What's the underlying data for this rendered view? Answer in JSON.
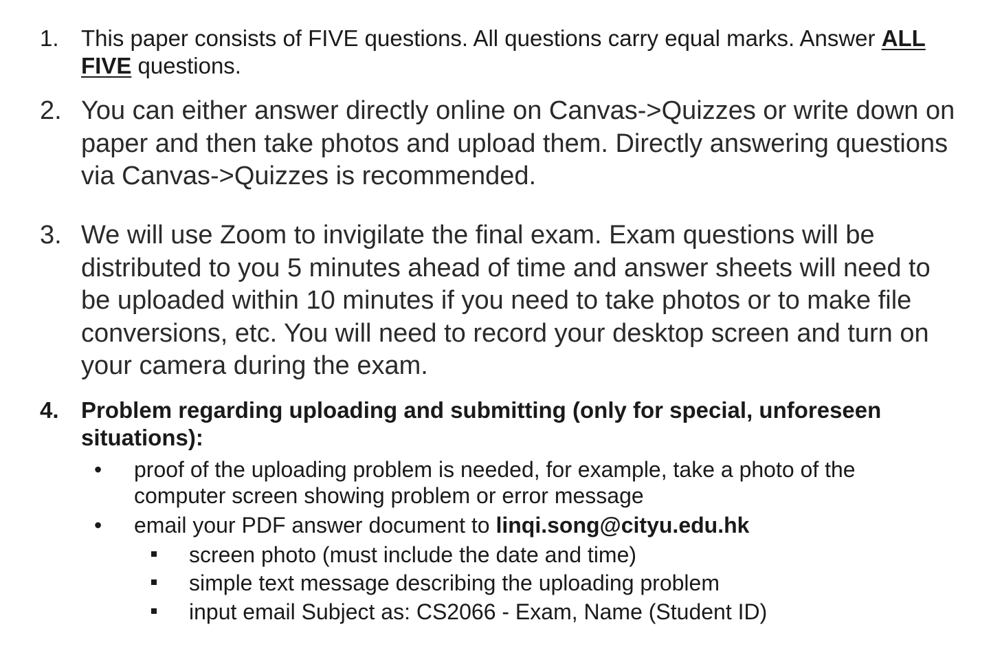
{
  "items": [
    {
      "number": "1.",
      "text_a": "This paper consists of FIVE questions. All questions carry equal marks. Answer ",
      "emph_all": "ALL",
      "emph_five": "FIVE",
      "text_b": " questions."
    },
    {
      "number": "2.",
      "text": "You can either answer directly online on Canvas->Quizzes or write down on paper and then take photos and upload them.  Directly answering questions via Canvas->Quizzes is recommended."
    },
    {
      "number": "3.",
      "text": "We will use Zoom to invigilate the final exam. Exam questions will be distributed to you 5 minutes ahead of time and answer sheets will need to be uploaded within 10 minutes if you need to take photos or to make file conversions, etc. You will need to record your desktop screen and turn on your camera during the exam."
    },
    {
      "number": "4.",
      "text": "Problem regarding uploading and submitting (only for special, unforeseen situations):",
      "bullets": [
        {
          "marker": "•",
          "text": "proof of the uploading problem is needed, for example, take a photo of the computer screen showing problem or error message"
        },
        {
          "marker": "•",
          "text": "email your PDF answer document to ",
          "email": "linqi.song@cityu.edu.hk"
        }
      ],
      "subbullets": [
        "screen photo (must include the date and time)",
        "simple text message describing the uploading problem",
        "input email Subject as: CS2066 -  Exam, Name (Student ID)"
      ]
    }
  ]
}
